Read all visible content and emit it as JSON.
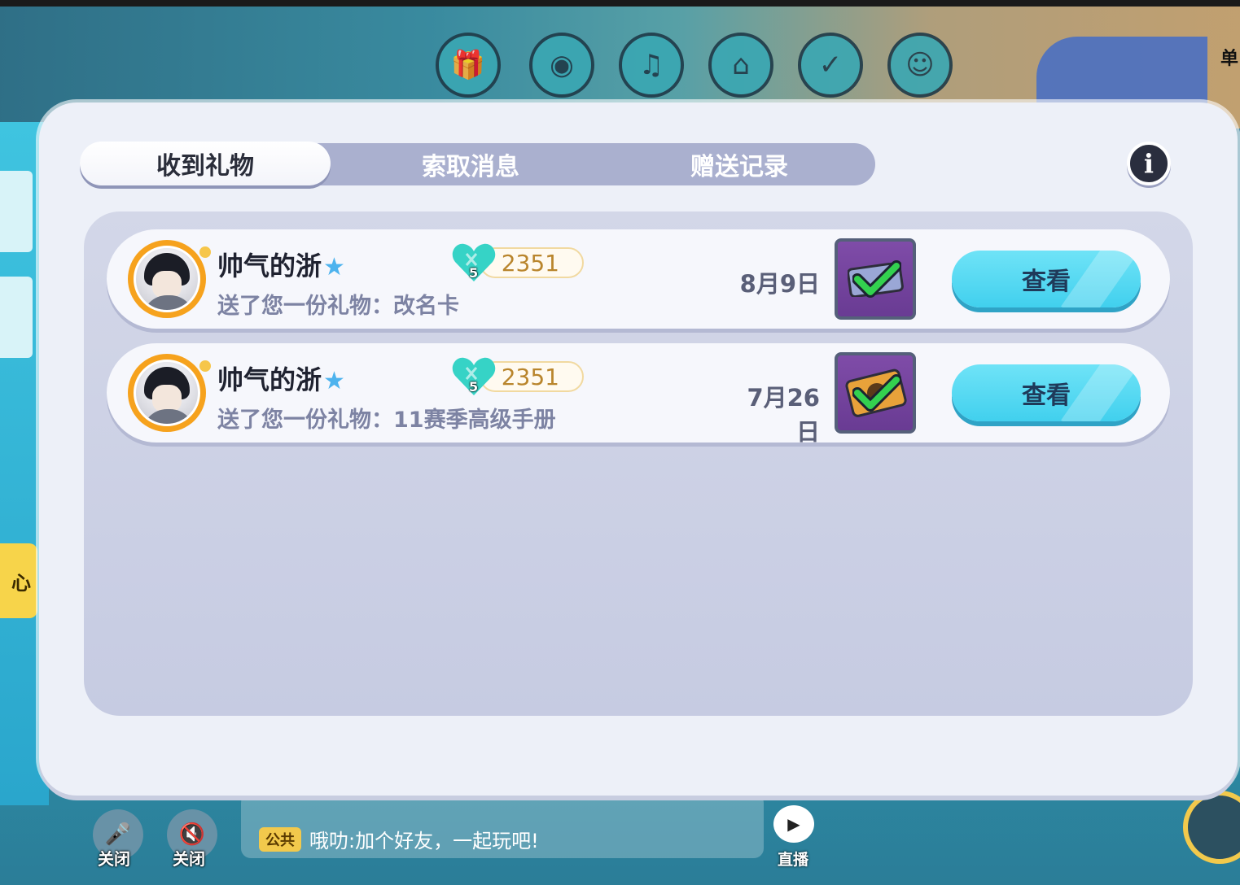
{
  "background": {
    "side_tab_label": "心",
    "corner_label": "单",
    "chat": {
      "tag": "公共",
      "message": "哦叻:加个好友，一起玩吧!"
    },
    "mic_label": "关闭",
    "speaker_label": "关闭",
    "live_label": "直播"
  },
  "tabs": [
    {
      "label": "收到礼物",
      "active": true
    },
    {
      "label": "索取消息",
      "active": false
    },
    {
      "label": "赠送记录",
      "active": false
    }
  ],
  "info_button": {
    "icon": "info-icon",
    "glyph": "i"
  },
  "gifts": [
    {
      "sender": "帅气的浙",
      "message": "送了您一份礼物：改名卡",
      "heart_level": "5",
      "score": "2351",
      "date": "8月9日",
      "view_label": "查看",
      "gift_icon": "rename-card-icon"
    },
    {
      "sender": "帅气的浙",
      "message": "送了您一份礼物：11赛季高级手册",
      "heart_level": "5",
      "score": "2351",
      "date": "7月26日",
      "view_label": "查看",
      "gift_icon": "season-handbook-icon"
    }
  ],
  "colors": {
    "accent_button": "#41d0ee",
    "tab_bar": "#aab0cf",
    "gift_bg": "#7f4ca8",
    "avatar_ring": "#f6a21d",
    "heart": "#36d3c6",
    "check": "#33d14f"
  }
}
